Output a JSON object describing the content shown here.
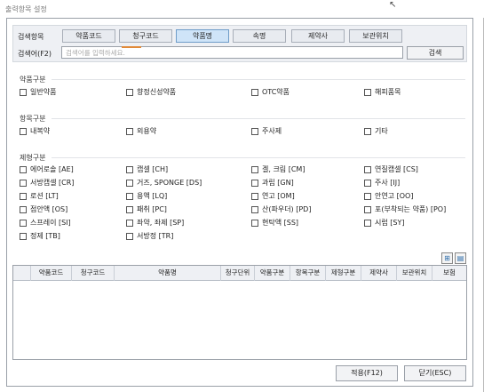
{
  "window": {
    "title": "출력항목 설정"
  },
  "search": {
    "label_category": "검색항목",
    "label_keyword": "검색어(F2)",
    "tabs": [
      "약품코드",
      "청구코드",
      "약품명",
      "속명",
      "제약사",
      "보관위치"
    ],
    "active_tab": "약품명",
    "placeholder": "검색어를 입력하세요.",
    "search_button": "검색"
  },
  "groups": {
    "drug_type": {
      "title": "약품구분",
      "items": [
        "일반약품",
        "향정신성약품",
        "OTC약품",
        "해피품목"
      ]
    },
    "item_type": {
      "title": "항목구분",
      "items": [
        "내복약",
        "외용약",
        "주사제",
        "기타"
      ]
    },
    "form_type": {
      "title": "제형구분",
      "items": [
        "에어로솔 [AE]",
        "캡셀 [CH]",
        "겔, 크림 [CM]",
        "연질캡셀 [CS]",
        "서방캡셀 [CR]",
        "거즈, SPONGE [DS]",
        "과립 [GN]",
        "주사 [IJ]",
        "로션 [LT]",
        "용액 [LQ]",
        "연고 [OM]",
        "안연고 [OO]",
        "점안액 [OS]",
        "패취 [PC]",
        "산(파우더) [PD]",
        "포(부착되는 약품) [PO]",
        "스프레이 [SI]",
        "좌약, 좌제 [SP]",
        "현탁액 [SS]",
        "시럽 [SY]",
        "정제 [TB]",
        "서방정 [TR]"
      ]
    }
  },
  "grid": {
    "columns": [
      "약품코드",
      "청구코드",
      "약품명",
      "청구단위",
      "약품구분",
      "항목구분",
      "제형구분",
      "제약사",
      "보관위치",
      "보험"
    ]
  },
  "footer": {
    "apply_button": "적용(F12)",
    "close_button": "닫기(ESC)"
  },
  "icons": {
    "grid_tool_1": "excel-export-icon",
    "grid_tool_2": "document-icon"
  }
}
